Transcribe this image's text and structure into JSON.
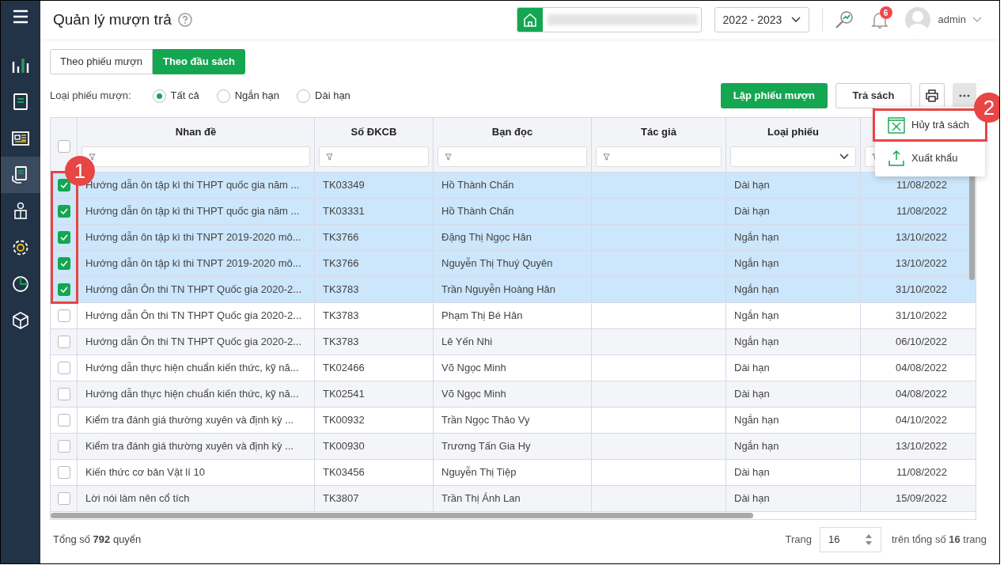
{
  "header": {
    "title": "Quản lý mượn trả",
    "school_year": "2022 - 2023",
    "notification_count": "6",
    "user": "admin"
  },
  "tabs": [
    {
      "label": "Theo phiếu mượn",
      "selected": false
    },
    {
      "label": "Theo đầu sách",
      "selected": true
    }
  ],
  "filter": {
    "label": "Loại phiếu mượn:",
    "options": [
      {
        "label": "Tất cả",
        "selected": true
      },
      {
        "label": "Ngắn hạn",
        "selected": false
      },
      {
        "label": "Dài hạn",
        "selected": false
      }
    ]
  },
  "actions": {
    "primary": "Lập phiếu mượn",
    "secondary": "Trả sách"
  },
  "menu": {
    "items": [
      {
        "label": "Hủy trả sách",
        "kind": "cancel",
        "highlighted": true
      },
      {
        "label": "Xuất khẩu",
        "kind": "export",
        "highlighted": false
      }
    ]
  },
  "table": {
    "all_checked": false,
    "columns": [
      {
        "label": "Nhan đề",
        "kind": "text"
      },
      {
        "label": "Số ĐKCB",
        "kind": "text"
      },
      {
        "label": "Bạn đọc",
        "kind": "text"
      },
      {
        "label": "Tác giả",
        "kind": "text"
      },
      {
        "label": "Loại phiếu",
        "kind": "select"
      },
      {
        "kind": "text"
      }
    ],
    "rows": [
      {
        "checked": true,
        "cells": [
          "Hướng dẫn ôn tập kì thi THPT quốc gia năm ...",
          "TK03349",
          "Hồ Thành Chấn",
          "",
          "Dài hạn",
          "11/08/2022"
        ]
      },
      {
        "checked": true,
        "cells": [
          "Hướng dẫn ôn tập kì thi THPT quốc gia năm ...",
          "TK03331",
          "Hồ Thành Chấn",
          "",
          "Dài hạn",
          "11/08/2022"
        ]
      },
      {
        "checked": true,
        "cells": [
          "Hướng dẫn ôn tập kì thi TNPT 2019-2020 mô...",
          "TK3766",
          "Đặng Thị Ngọc Hân",
          "",
          "Ngắn hạn",
          "13/10/2022"
        ]
      },
      {
        "checked": true,
        "cells": [
          "Hướng dẫn ôn tập kì thi TNPT 2019-2020 mô...",
          "TK3766",
          "Nguyễn Thị Thuý Quyên",
          "",
          "Ngắn hạn",
          "13/10/2022"
        ]
      },
      {
        "checked": true,
        "cells": [
          "Hướng dẫn Ôn thi TN THPT Quốc gia 2020-2...",
          "TK3783",
          "Trần Nguyễn Hoàng Hân",
          "",
          "Ngắn hạn",
          "31/10/2022"
        ]
      },
      {
        "checked": false,
        "cells": [
          "Hướng dẫn Ôn thi TN THPT Quốc gia 2020-2...",
          "TK3783",
          "Phạm Thị Bé Hân",
          "",
          "Ngắn hạn",
          "31/10/2022"
        ]
      },
      {
        "checked": false,
        "cells": [
          "Hướng dẫn Ôn thi TN THPT Quốc gia 2020-2...",
          "TK3783",
          "Lê Yến Nhi",
          "",
          "Ngắn hạn",
          "06/10/2022"
        ]
      },
      {
        "checked": false,
        "cells": [
          "Hướng dẫn thực hiện chuẩn kiến thức, kỹ nă...",
          "TK02466",
          "Võ Ngọc Minh",
          "",
          "Dài hạn",
          "04/08/2022"
        ]
      },
      {
        "checked": false,
        "cells": [
          "Hướng dẫn thực hiện chuẩn kiến thức, kỹ nă...",
          "TK02541",
          "Võ Ngọc Minh",
          "",
          "Dài hạn",
          "04/08/2022"
        ]
      },
      {
        "checked": false,
        "cells": [
          "Kiểm tra đánh giá thường xuyên và định kỳ ...",
          "TK00932",
          "Trần Ngọc Thảo Vy",
          "",
          "Ngắn hạn",
          "04/10/2022"
        ]
      },
      {
        "checked": false,
        "cells": [
          "Kiểm tra đánh giá thường xuyên và định kỳ ...",
          "TK00930",
          "Trương Tấn Gia Hy",
          "",
          "Ngắn hạn",
          "13/10/2022"
        ]
      },
      {
        "checked": false,
        "cells": [
          "Kiến thức cơ bản Vật lí 10",
          "TK03456",
          "Nguyễn Thị Tiệp",
          "",
          "Dài hạn",
          "11/08/2022"
        ]
      },
      {
        "checked": false,
        "cells": [
          "Lời nói làm nên cổ tích",
          "TK3807",
          "Trần Thị Ánh Lan",
          "",
          "Dài hạn",
          "15/09/2022"
        ]
      }
    ]
  },
  "footer": {
    "total": "Tổng số **792** quyển",
    "page_label": "Trang",
    "page": "16",
    "page_total": "trên tổng số **16** trang"
  },
  "annotations": [
    {
      "label": "1"
    },
    {
      "label": "2"
    }
  ]
}
